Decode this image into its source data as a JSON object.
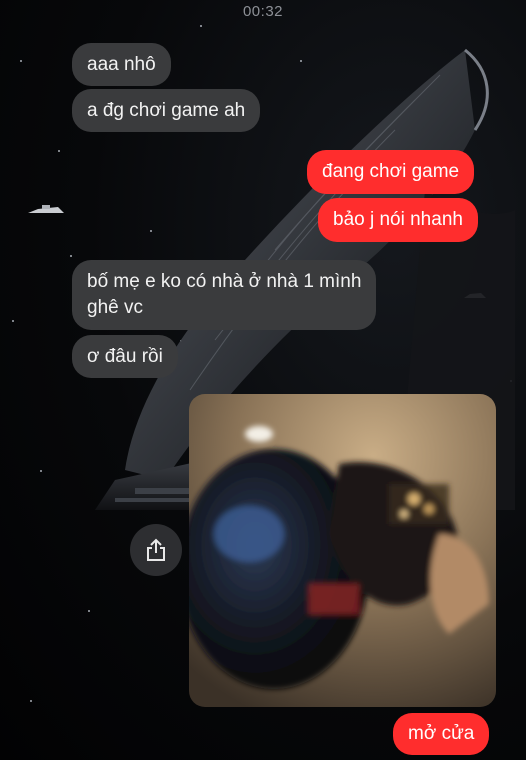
{
  "status": {
    "time": "00:32"
  },
  "messages": [
    {
      "side": "in",
      "text": "aaa nhô"
    },
    {
      "side": "in",
      "text": "a đg chơi game ah"
    },
    {
      "side": "out",
      "text": "đang chơi game"
    },
    {
      "side": "out",
      "text": "bảo j nói nhanh"
    },
    {
      "side": "in",
      "text": "bố mẹ e ko có nhà ở nhà 1 mình",
      "text2": "ghê vc"
    },
    {
      "side": "in",
      "text": "ơ đâu rồi"
    },
    {
      "side": "out",
      "text": "mở cửa"
    }
  ],
  "photo": {
    "subject": "blurry close-up photo of a helmet-like object in dim light"
  },
  "colors": {
    "incoming_bubble": "#3a3b3d",
    "outgoing_bubble": "#ff2d2d",
    "background": "#050608"
  },
  "icons": {
    "share": "share-icon"
  }
}
